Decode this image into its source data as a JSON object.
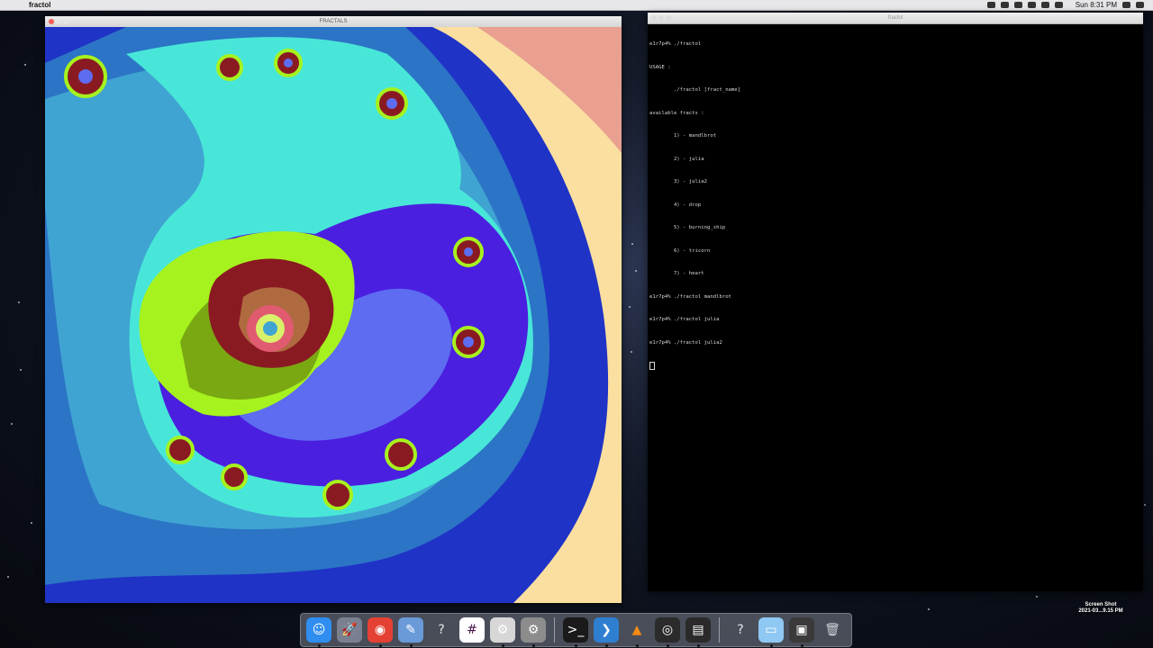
{
  "menubar": {
    "apple": "",
    "app_name": "fractol",
    "clock": "Sun 8:31 PM"
  },
  "fractal_window": {
    "title": "FRACTALS"
  },
  "terminal_window": {
    "title": "fractol",
    "lines": [
      "e1r7p4% ./fractol",
      "USAGE :",
      "        ./fractol [fract_name]",
      "available fracts :",
      "        1) - mandlbrot",
      "        2) - julia",
      "        3) - julia2",
      "        4) - drop",
      "        5) - burning_ship",
      "        6) - tricorn",
      "        7) - heart",
      "e1r7p4% ./fractol mandlbrot",
      "e1r7p4% ./fractol julia",
      "e1r7p4% ./fractol julia2"
    ]
  },
  "dock": {
    "items": [
      {
        "name": "finder-icon",
        "glyph": "☺",
        "color": "#2f8ef0"
      },
      {
        "name": "launchpad-icon",
        "glyph": "🚀",
        "color": "#7a8090"
      },
      {
        "name": "chrome-icon",
        "glyph": "◉",
        "color": "#e44134"
      },
      {
        "name": "preview-icon",
        "glyph": "✎",
        "color": "#6a9bd8"
      },
      {
        "name": "unknown-app-icon",
        "glyph": "?",
        "color": "transparent"
      },
      {
        "name": "slack-icon",
        "glyph": "#",
        "color": "#ffffff"
      },
      {
        "name": "xcode-installer-icon",
        "glyph": "⚙",
        "color": "#d7d7d7"
      },
      {
        "name": "system-preferences-icon",
        "glyph": "⚙",
        "color": "#8c8c8c"
      },
      {
        "name": "terminal-icon",
        "glyph": ">_",
        "color": "#1a1a1a"
      },
      {
        "name": "vscode-icon",
        "glyph": "❯",
        "color": "#2f7fd0"
      },
      {
        "name": "vlc-icon",
        "glyph": "▲",
        "color": "transparent"
      },
      {
        "name": "obs-icon",
        "glyph": "◎",
        "color": "#2b2b2b"
      },
      {
        "name": "console-icon",
        "glyph": "▤",
        "color": "#2a2a2a"
      },
      {
        "name": "unknown-app-2-icon",
        "glyph": "?",
        "color": "transparent"
      },
      {
        "name": "folder-icon",
        "glyph": "▭",
        "color": "#8fc8f2"
      },
      {
        "name": "screen-recording-icon",
        "glyph": "▣",
        "color": "#3a3a3a"
      },
      {
        "name": "trash-icon",
        "glyph": "🗑",
        "color": "transparent"
      }
    ]
  },
  "desktop_file": {
    "line1": "Screen Shot",
    "line2": "2021-03...9.15 PM"
  },
  "colors": {
    "fractal_bg": "#fadfa0",
    "fractal_salmon": "#e9a090",
    "deep_blue": "#1f33c6",
    "mid_blue": "#2c74c6",
    "sky_blue": "#3fa4d2",
    "cyan": "#48e6d8",
    "violet": "#4b1fe0",
    "periwinkle": "#5d6cf0",
    "lime": "#a6f21e",
    "olive": "#7aa812",
    "maroon": "#8a1a22",
    "brown": "#b06a40"
  }
}
